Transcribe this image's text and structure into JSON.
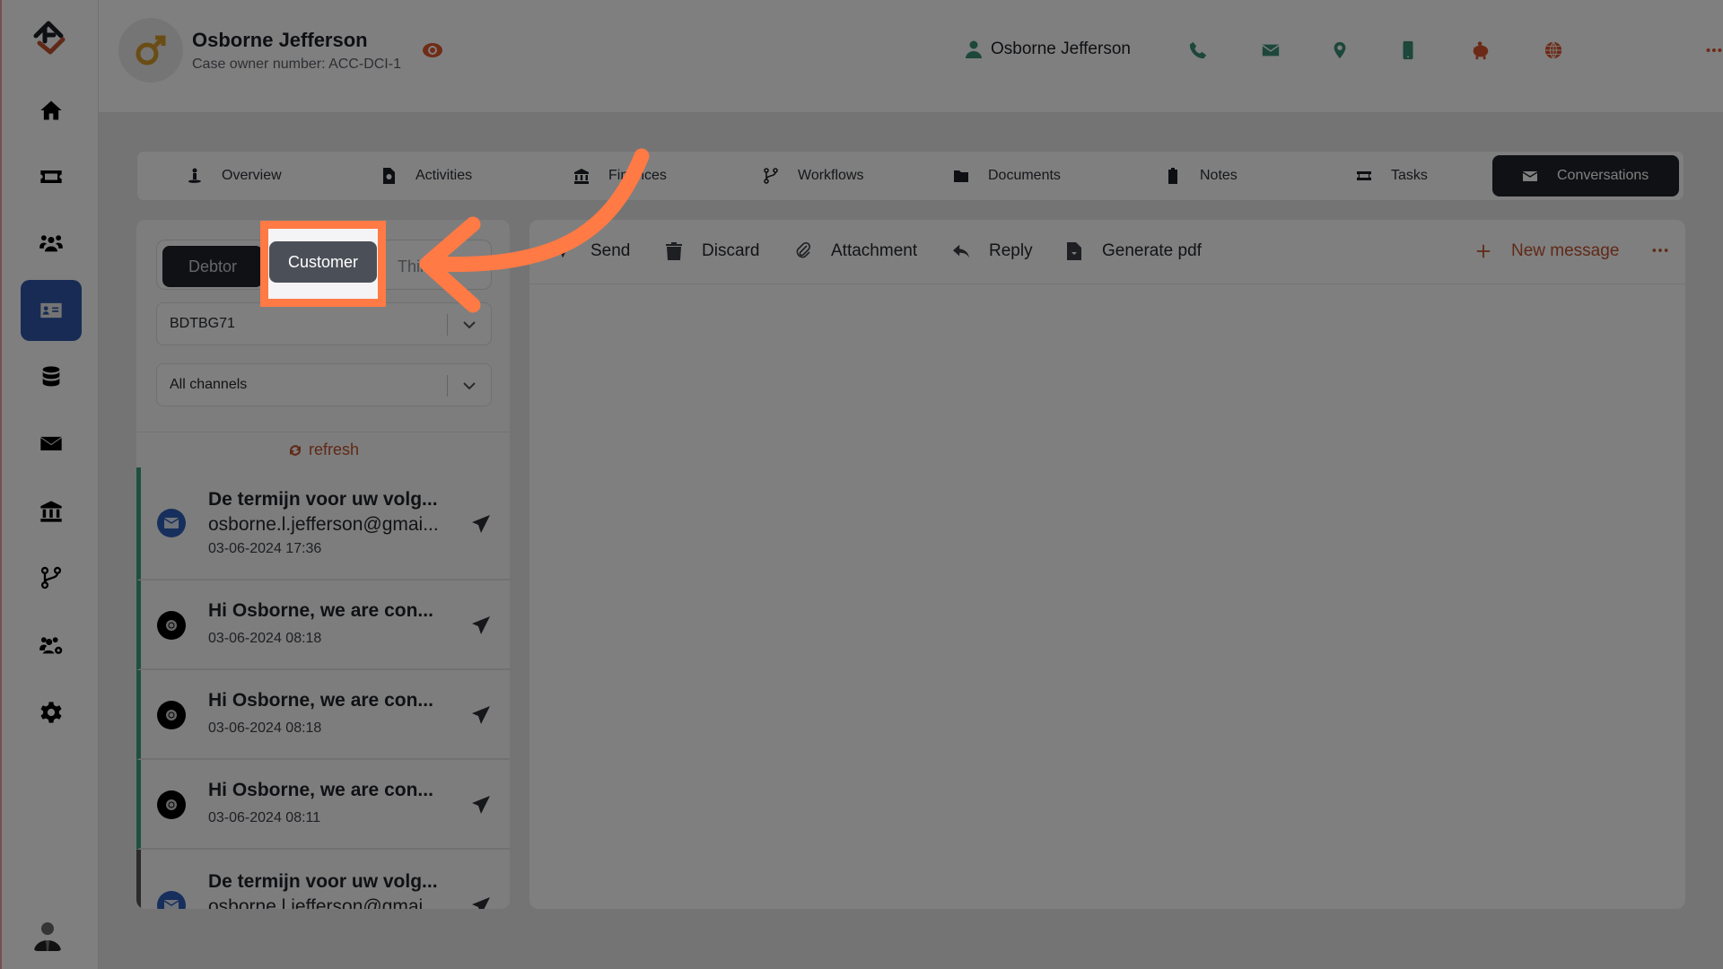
{
  "colors": {
    "accent_orange": "#ff7a45",
    "brand_blue": "#2f56a8",
    "teal": "#3aa17e",
    "rust": "#c0532e",
    "dark": "#1f2228"
  },
  "sidebar": {
    "items": [
      {
        "icon": "home-icon",
        "label": "Home"
      },
      {
        "icon": "ticket-icon",
        "label": "Tickets"
      },
      {
        "icon": "users-icon",
        "label": "Users"
      },
      {
        "icon": "id-card-icon",
        "label": "Cases",
        "active": true
      },
      {
        "icon": "database-icon",
        "label": "Database"
      },
      {
        "icon": "envelope-icon",
        "label": "Mail"
      },
      {
        "icon": "bank-icon",
        "label": "Finance"
      },
      {
        "icon": "branch-icon",
        "label": "Workflows"
      },
      {
        "icon": "users-gear-icon",
        "label": "Teams"
      },
      {
        "icon": "gear-icon",
        "label": "Settings"
      }
    ]
  },
  "header": {
    "name": "Osborne Jefferson",
    "subtitle": "Case owner number: ACC-DCI-1",
    "contact_name": "Osborne Jefferson",
    "action_icons": [
      "phone-icon",
      "envelope-icon",
      "location-pin-icon",
      "mobile-icon",
      "piggy-bank-icon",
      "globe-icon",
      "more-icon",
      "chevron-down-icon"
    ]
  },
  "tabs": [
    {
      "label": "Overview",
      "icon": "overview-icon"
    },
    {
      "label": "Activities",
      "icon": "file-search-icon"
    },
    {
      "label": "Finances",
      "icon": "bank-icon"
    },
    {
      "label": "Workflows",
      "icon": "branch-icon"
    },
    {
      "label": "Documents",
      "icon": "folder-icon"
    },
    {
      "label": "Notes",
      "icon": "clipboard-icon"
    },
    {
      "label": "Tasks",
      "icon": "ticket-icon"
    },
    {
      "label": "Conversations",
      "icon": "envelope-icon",
      "active": true
    }
  ],
  "conversation": {
    "segments": [
      "Debtor",
      "Customer",
      "Third"
    ],
    "selected_segment": "Customer",
    "account_select": "BDTBG71",
    "channel_select": "All channels",
    "refresh_label": "refresh",
    "messages": [
      {
        "title": "De termijn voor uw volg...",
        "email": "osborne.l.jefferson@gmai...",
        "date": "03-06-2024 17:36",
        "type": "email"
      },
      {
        "title": "Hi Osborne, we are con...",
        "date": "03-06-2024 08:18",
        "type": "other"
      },
      {
        "title": "Hi Osborne, we are con...",
        "date": "03-06-2024 08:18",
        "type": "other"
      },
      {
        "title": "Hi Osborne, we are con...",
        "date": "03-06-2024 08:11",
        "type": "other"
      },
      {
        "title": "De termijn voor uw volg...",
        "email": "osborne.l.jefferson@gmai...",
        "type": "email"
      }
    ]
  },
  "toolbar": {
    "send": "Send",
    "discard": "Discard",
    "attachment": "Attachment",
    "reply": "Reply",
    "generate_pdf": "Generate pdf",
    "new_message": "New message"
  }
}
